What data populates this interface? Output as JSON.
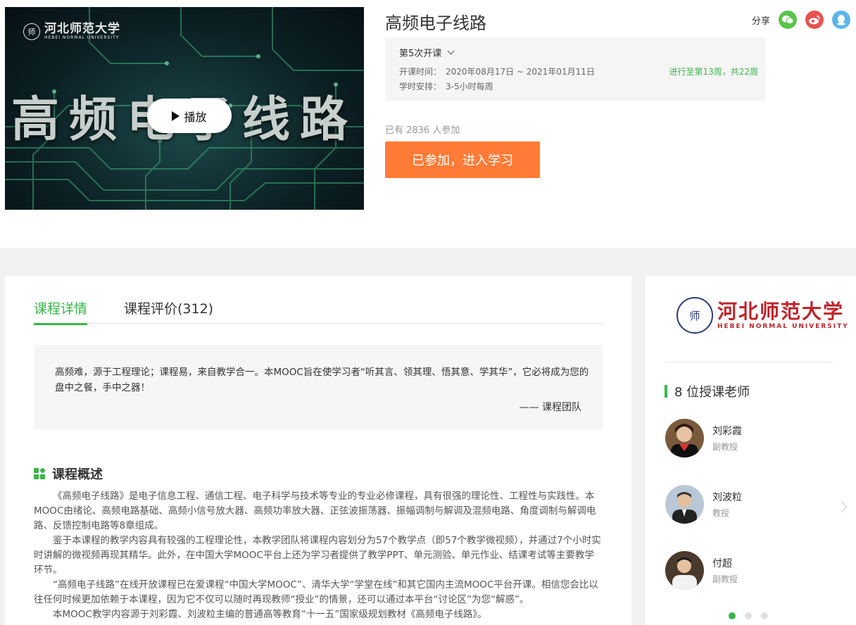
{
  "video": {
    "uni_short_cn": "河北师范大学",
    "uni_en": "HEBEI NORMAL UNIVERSITY",
    "title_art": "高频电子线路",
    "play_label": "播放"
  },
  "course": {
    "title": "高频电子线路",
    "share_label": "分享"
  },
  "term": {
    "selected": "第5次开课",
    "time_label": "开课时间：",
    "time_value": "2020年08月17日 ~ 2021年01月11日",
    "schedule_label": "学时安排：",
    "schedule_value": "3-5小时每周",
    "progress": "进行至第13周，共22周"
  },
  "participants": "已有 2836 人参加",
  "join_button": "已参加，进入学习",
  "tabs": [
    {
      "label": "课程详情"
    },
    {
      "label": "课程评价(312)"
    }
  ],
  "quote": {
    "text": "高频难，源于工程理论；课程易，来自教学合一。本MOOC旨在使学习者“听其言、领其理、悟其意、学其华”，它必将成为您的盘中之餐，手中之器！",
    "signature": "—— 课程团队"
  },
  "overview": {
    "title": "课程概述",
    "paragraphs": [
      "《高频电子线路》是电子信息工程、通信工程、电子科学与技术等专业的专业必修课程，具有很强的理论性、工程性与实践性。本MOOC由绪论、高频电路基础、高频小信号放大器、高频功率放大器、正弦波振荡器、振幅调制与解调及混频电路、角度调制与解调电路、反馈控制电路等8章组成。",
      "鉴于本课程的教学内容具有较强的工程理论性，本教学团队将课程内容划分为57个教学点（即57个教学微视频），并通过7个小时实时讲解的微视频再现其精华。此外，在中国大学MOOC平台上还为学习者提供了教学PPT、单元测验、单元作业、结课考试等主要教学环节。",
      "“高频电子线路”在线开放课程已在爱课程“中国大学MOOC”、清华大学“学堂在线”和其它国内主流MOOC平台开课。相信您会比以往任何时候更加依赖于本课程，因为它不仅可以随时再现教师“授业”的情景，还可以通过本平台“讨论区”为您“解惑”。",
      "本MOOC教学内容源于刘彩霞、刘波粒主编的普通高等教育“十一五”国家级规划教材《高频电子线路》。"
    ]
  },
  "side": {
    "uni_cn": "河北师范大学",
    "uni_en": "HEBEI NORMAL UNIVERSITY",
    "teachers_title": "8 位授课老师",
    "teachers": [
      {
        "name": "刘彩霞",
        "title": "副教授"
      },
      {
        "name": "刘波粒",
        "title": "教授"
      },
      {
        "name": "付超",
        "title": "副教授"
      }
    ]
  },
  "colors": {
    "accent_green": "#39b54a",
    "join_orange": "#ff7b36",
    "wechat": "#5ac34a",
    "weibo": "#e8534e",
    "qq": "#5ab6ec"
  }
}
